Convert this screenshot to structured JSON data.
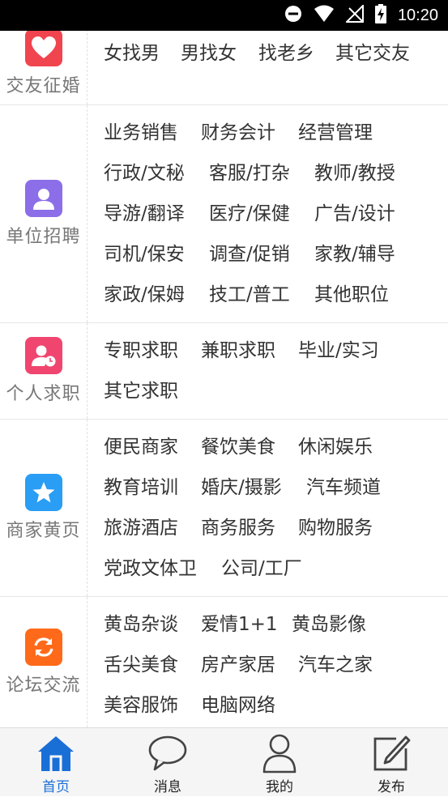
{
  "status_bar": {
    "time": "10:20",
    "icons": [
      "do-not-disturb-icon",
      "wifi-icon",
      "no-signal-icon",
      "battery-charging-icon"
    ]
  },
  "sections": [
    {
      "label": "交友征婚",
      "icon": "heart-icon",
      "icon_color": "#f0454f",
      "items": [
        "女找男",
        "男找女",
        "找老乡",
        "其它交友"
      ]
    },
    {
      "label": "单位招聘",
      "icon": "person-icon",
      "icon_color": "#8b6ee8",
      "items": [
        "业务销售",
        "财务会计",
        "经营管理",
        "行政/文秘",
        "客服/打杂",
        "教师/教授",
        "导游/翻译",
        "医疗/保健",
        "广告/设计",
        "司机/保安",
        "调查/促销",
        "家教/辅导",
        "家政/保姆",
        "技工/普工",
        "其他职位"
      ]
    },
    {
      "label": "个人求职",
      "icon": "person-clock-icon",
      "icon_color": "#f0456f",
      "items": [
        "专职求职",
        "兼职求职",
        "毕业/实习",
        "其它求职"
      ]
    },
    {
      "label": "商家黄页",
      "icon": "star-icon",
      "icon_color": "#2a9df4",
      "items": [
        "便民商家",
        "餐饮美食",
        "休闲娱乐",
        "教育培训",
        "婚庆/摄影",
        "汽车频道",
        "旅游酒店",
        "商务服务",
        "购物服务",
        "党政文体卫",
        "公司/工厂"
      ]
    },
    {
      "label": "论坛交流",
      "icon": "refresh-icon",
      "icon_color": "#ff6a1a",
      "items": [
        "黄岛杂谈",
        "爱情1+1",
        "黄岛影像",
        "舌尖美食",
        "房产家居",
        "汽车之家",
        "美容服饰",
        "电脑网络"
      ]
    }
  ],
  "tabs": [
    {
      "label": "首页",
      "icon": "home-icon",
      "active": true
    },
    {
      "label": "消息",
      "icon": "chat-bubble-icon",
      "active": false
    },
    {
      "label": "我的",
      "icon": "user-icon",
      "active": false
    },
    {
      "label": "发布",
      "icon": "edit-icon",
      "active": false
    }
  ],
  "colors": {
    "active_tab": "#1a6fd6",
    "text": "#333333",
    "label": "#777777"
  }
}
